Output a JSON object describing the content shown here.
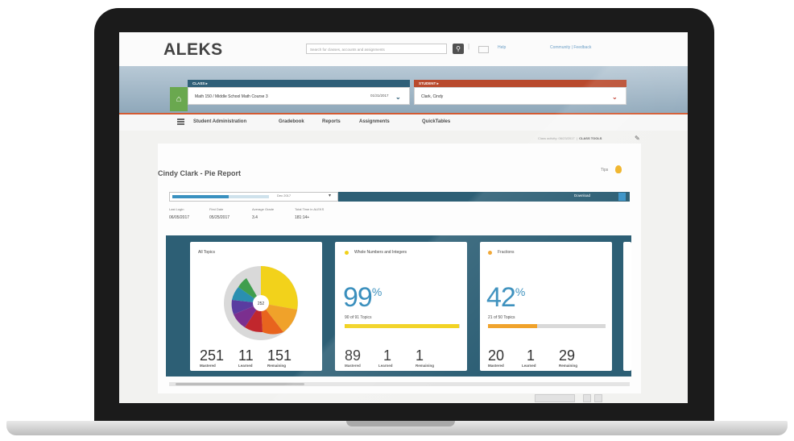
{
  "header": {
    "logo": "ALEKS",
    "search_placeholder": "Search for classes, accounts and assignments",
    "help": "Help",
    "links": "Community  |  Feedback"
  },
  "class_selector": {
    "label": "CLASS",
    "value": "Math 150 / Middle School Math Course 3",
    "date_range": "01/31/2017"
  },
  "student_selector": {
    "label": "STUDENT",
    "value": "Clark, Cindy"
  },
  "nav": {
    "items": [
      "Student Administration",
      "Gradebook",
      "Reports",
      "Assignments",
      "QuickTables"
    ]
  },
  "toolbar": {
    "class_info": "Class activity: 06/23/2017",
    "class_tools": "CLASS TOOLS"
  },
  "report": {
    "title": "Cindy Clark - Pie Report",
    "tips_label": "Tips",
    "progress_select_text": "Dec 2017",
    "download_label": "Download",
    "stats": [
      {
        "label": "Last Login",
        "value": "06/05/2017"
      },
      {
        "label": "First Date",
        "value": "05/25/2017"
      },
      {
        "label": "Average Grade",
        "value": "3.4"
      },
      {
        "label": "Total Time in ALEKS",
        "value": "181:14+"
      }
    ]
  },
  "cards": [
    {
      "title": "All Topics",
      "pie_center": "252",
      "counts": [
        {
          "value": "251",
          "label": "Mastered"
        },
        {
          "value": "11",
          "label": "Learned"
        },
        {
          "value": "151",
          "label": "Remaining"
        }
      ]
    },
    {
      "title": "Whole Numbers and Integers",
      "dot_color": "#f1d11a",
      "percent": "99",
      "percent_symbol": "%",
      "subtext": "90 of 91 Topics",
      "progress": 0.99,
      "bar_color": "#f1d11a",
      "counts": [
        {
          "value": "89",
          "label": "Mastered"
        },
        {
          "value": "1",
          "label": "Learned"
        },
        {
          "value": "1",
          "label": "Remaining"
        }
      ]
    },
    {
      "title": "Fractions",
      "dot_color": "#f0a22a",
      "percent": "42",
      "percent_symbol": "%",
      "subtext": "21 of 50 Topics",
      "progress": 0.42,
      "bar_color": "#f0a22a",
      "counts": [
        {
          "value": "20",
          "label": "Mastered"
        },
        {
          "value": "1",
          "label": "Learned"
        },
        {
          "value": "29",
          "label": "Remaining"
        }
      ]
    }
  ],
  "colors": {
    "class_header": "#2f5f78",
    "student_header": "#b94a2d",
    "home_button": "#6aa84f",
    "card_band": "#2d5f75",
    "percent_text": "#3a8fbd"
  }
}
